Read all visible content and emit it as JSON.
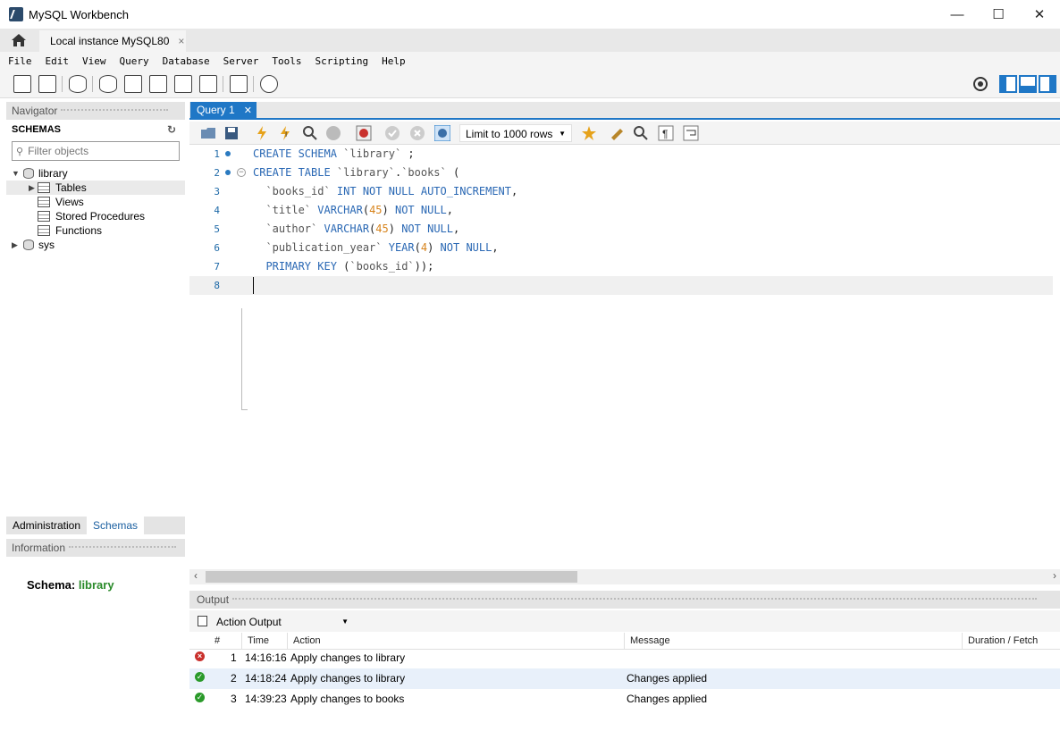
{
  "window": {
    "title": "MySQL Workbench"
  },
  "connection_tab": {
    "label": "Local instance MySQL80",
    "close": "×"
  },
  "menu": [
    "File",
    "Edit",
    "View",
    "Query",
    "Database",
    "Server",
    "Tools",
    "Scripting",
    "Help"
  ],
  "navigator": {
    "header": "Navigator",
    "schemas_title": "SCHEMAS",
    "filter_placeholder": "Filter objects",
    "tree": {
      "library": "library",
      "tables": "Tables",
      "views": "Views",
      "stored_procedures": "Stored Procedures",
      "functions": "Functions",
      "sys": "sys"
    },
    "tabs": {
      "administration": "Administration",
      "schemas": "Schemas"
    }
  },
  "information": {
    "header": "Information",
    "schema_label": "Schema:",
    "schema_value": "library"
  },
  "editor": {
    "tab_label": "Query 1",
    "limit": "Limit to 1000 rows",
    "line_numbers": [
      "1",
      "2",
      "3",
      "4",
      "5",
      "6",
      "7",
      "8"
    ],
    "lines": [
      [
        {
          "t": "CREATE SCHEMA ",
          "c": "kw"
        },
        {
          "t": "`library`",
          "c": "id"
        },
        {
          "t": " ;",
          "c": "plain"
        }
      ],
      [
        {
          "t": "CREATE TABLE ",
          "c": "kw"
        },
        {
          "t": "`library`",
          "c": "id"
        },
        {
          "t": ".",
          "c": "plain"
        },
        {
          "t": "`books`",
          "c": "id"
        },
        {
          "t": " (",
          "c": "plain"
        }
      ],
      [
        {
          "t": "  ",
          "c": "plain"
        },
        {
          "t": "`books_id`",
          "c": "id"
        },
        {
          "t": " INT NOT NULL AUTO_INCREMENT",
          "c": "kw"
        },
        {
          "t": ",",
          "c": "plain"
        }
      ],
      [
        {
          "t": "  ",
          "c": "plain"
        },
        {
          "t": "`title`",
          "c": "id"
        },
        {
          "t": " VARCHAR",
          "c": "kw"
        },
        {
          "t": "(",
          "c": "plain"
        },
        {
          "t": "45",
          "c": "num"
        },
        {
          "t": ")",
          "c": "plain"
        },
        {
          "t": " NOT NULL",
          "c": "kw"
        },
        {
          "t": ",",
          "c": "plain"
        }
      ],
      [
        {
          "t": "  ",
          "c": "plain"
        },
        {
          "t": "`author`",
          "c": "id"
        },
        {
          "t": " VARCHAR",
          "c": "kw"
        },
        {
          "t": "(",
          "c": "plain"
        },
        {
          "t": "45",
          "c": "num"
        },
        {
          "t": ")",
          "c": "plain"
        },
        {
          "t": " NOT NULL",
          "c": "kw"
        },
        {
          "t": ",",
          "c": "plain"
        }
      ],
      [
        {
          "t": "  ",
          "c": "plain"
        },
        {
          "t": "`publication_year`",
          "c": "id"
        },
        {
          "t": " YEAR",
          "c": "kw"
        },
        {
          "t": "(",
          "c": "plain"
        },
        {
          "t": "4",
          "c": "num"
        },
        {
          "t": ")",
          "c": "plain"
        },
        {
          "t": " NOT NULL",
          "c": "kw"
        },
        {
          "t": ",",
          "c": "plain"
        }
      ],
      [
        {
          "t": "  PRIMARY KEY ",
          "c": "kw"
        },
        {
          "t": "(",
          "c": "plain"
        },
        {
          "t": "`books_id`",
          "c": "id"
        },
        {
          "t": "));",
          "c": "plain"
        }
      ],
      []
    ]
  },
  "output": {
    "header": "Output",
    "selector": "Action Output",
    "columns": [
      "#",
      "Time",
      "Action",
      "Message",
      "Duration / Fetch"
    ],
    "rows": [
      {
        "status": "error",
        "num": "1",
        "time": "14:16:16",
        "action": "Apply changes to library",
        "message": "",
        "duration": ""
      },
      {
        "status": "ok",
        "num": "2",
        "time": "14:18:24",
        "action": "Apply changes to library",
        "message": "Changes applied",
        "duration": ""
      },
      {
        "status": "ok",
        "num": "3",
        "time": "14:39:23",
        "action": "Apply changes to books",
        "message": "Changes applied",
        "duration": ""
      }
    ]
  },
  "colors": {
    "accent": "#1f77c6",
    "keyword": "#2a68b4",
    "number": "#d7831b",
    "ok": "#2a9a2a",
    "error": "#c9302c",
    "schema_value": "#2a8a2a"
  }
}
